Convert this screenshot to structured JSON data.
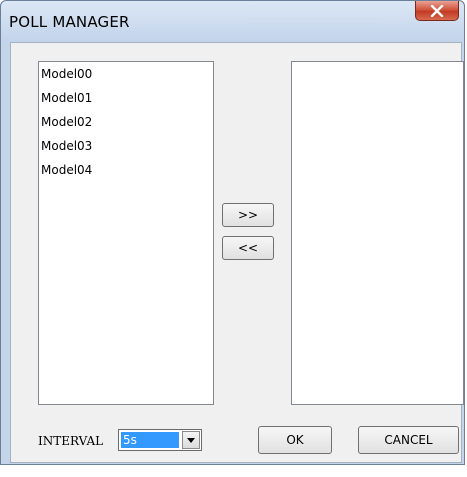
{
  "window": {
    "title": "POLL MANAGER"
  },
  "left_list": {
    "items": [
      "Model00",
      "Model01",
      "Model02",
      "Model03",
      "Model04"
    ]
  },
  "right_list": {
    "items": []
  },
  "buttons": {
    "add_label": ">>",
    "remove_label": "<<",
    "ok_label": "OK",
    "cancel_label": "CANCEL"
  },
  "interval": {
    "label": "INTERVAL",
    "selected": "5s"
  },
  "colors": {
    "selection": "#3399ff",
    "close_button": "#c23a24",
    "frame": "#c5d5e9"
  },
  "icons": {
    "close": "close-x-icon",
    "dropdown": "chevron-down-icon"
  }
}
